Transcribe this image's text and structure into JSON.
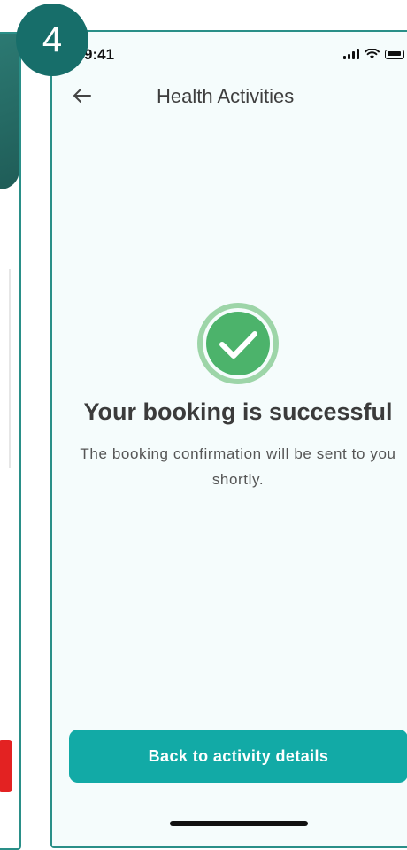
{
  "step_badge": {
    "number": "4"
  },
  "status_bar": {
    "time": "9:41"
  },
  "nav": {
    "title": "Health Activities",
    "back_icon": "arrow-left-icon"
  },
  "success": {
    "icon": "check-circle-icon",
    "title": "Your booking is successful",
    "message": "The booking confirmation will be sent to you shortly."
  },
  "actions": {
    "back_button_label": "Back to activity details"
  },
  "colors": {
    "accent": "#12aaa6",
    "badge": "#176e6a",
    "success_green": "#4cb36b",
    "success_ring": "#9dd5a8",
    "screen_background": "#f5fcfc",
    "frame_border": "#2a8f88"
  }
}
